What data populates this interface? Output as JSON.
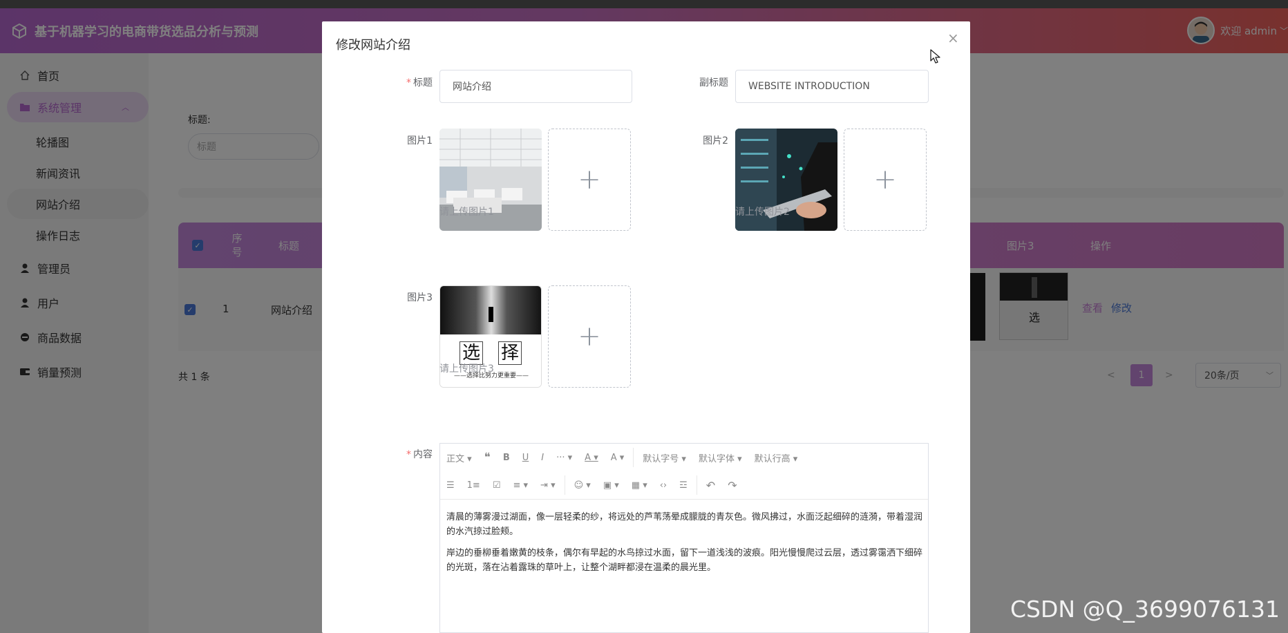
{
  "app": {
    "title": "基于机器学习的电商带货选品分析与预测",
    "welcome": "欢迎 admin"
  },
  "sidebar": {
    "items": [
      {
        "label": "首页",
        "icon": "home-icon"
      },
      {
        "label": "系统管理",
        "icon": "folder-icon"
      },
      {
        "label": "轮播图"
      },
      {
        "label": "新闻资讯"
      },
      {
        "label": "网站介绍"
      },
      {
        "label": "操作日志"
      },
      {
        "label": "管理员",
        "icon": "user-icon"
      },
      {
        "label": "用户",
        "icon": "user-icon"
      },
      {
        "label": "商品数据",
        "icon": "circle-icon"
      },
      {
        "label": "销量预测",
        "icon": "wallet-icon"
      }
    ]
  },
  "search": {
    "label": "标题:",
    "placeholder": "标题"
  },
  "table": {
    "headers": {
      "index": "序号",
      "title": "标题",
      "pic3": "图片3",
      "actions": "操作"
    },
    "row": {
      "index": "1",
      "title": "网站介绍"
    },
    "actions": {
      "view": "查看",
      "edit": "修改"
    }
  },
  "pagination": {
    "total": "共 1 条",
    "prev": "<",
    "page": "1",
    "next": ">",
    "size": "20条/页"
  },
  "dialog": {
    "title": "修改网站介绍",
    "close": "×",
    "title_label": "标题",
    "title_value": "网站介绍",
    "subtitle_label": "副标题",
    "subtitle_value": "WEBSITE INTRODUCTION",
    "pic1_label": "图片1",
    "pic1_hint": "请上传图片1",
    "pic2_label": "图片2",
    "pic2_hint": "请上传图片2",
    "pic3_label": "图片3",
    "pic3_hint": "请上传图片3",
    "upload_plus": "+",
    "pic3_text": {
      "char1": "选",
      "char2": "择",
      "caption": "——选择比努力更重要——"
    },
    "content_label": "内容",
    "editor": {
      "row1": [
        "正文 ▾",
        "❝",
        "B",
        "U",
        "I",
        "··· ▾",
        "A ▾",
        "A ▾",
        "默认字号 ▾",
        "默认字体 ▾",
        "默认行高 ▾"
      ],
      "row2": [
        "☰",
        "1≡",
        "☑",
        "≡ ▾",
        "⇥ ▾",
        "☺ ▾",
        "▣ ▾",
        "▦ ▾",
        "‹›",
        "☲",
        "↶",
        "↷"
      ],
      "paragraphs": [
        "清晨的薄雾漫过湖面，像一层轻柔的纱，将远处的芦苇荡晕成朦胧的青灰色。微风拂过，水面泛起细碎的涟漪，带着湿润的水汽掠过脸颊。",
        "岸边的垂柳垂着嫩黄的枝条，偶尔有早起的水鸟掠过水面，留下一道浅浅的波痕。阳光慢慢爬过云层，透过雾霭洒下细碎的光斑，落在沾着露珠的草叶上，让整个湖畔都浸在温柔的晨光里。"
      ]
    }
  },
  "watermark": "CSDN @Q_3699076131"
}
